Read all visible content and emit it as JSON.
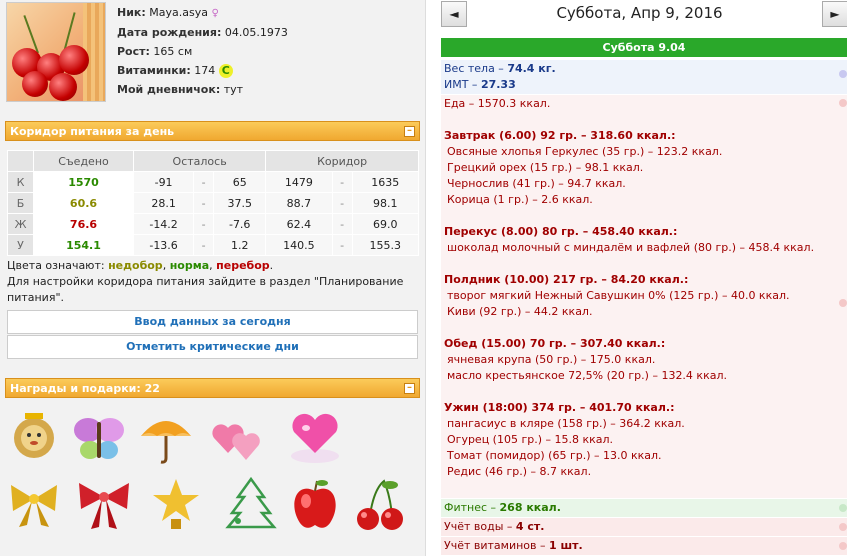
{
  "profile": {
    "nick_label": "Ник:",
    "nick": "Maya.asya",
    "birth_label": "Дата рождения:",
    "birth": "04.05.1973",
    "height_label": "Рост:",
    "height": "165 см",
    "vitamins_label": "Витаминки:",
    "vitamins": "174",
    "vitamin_badge": "C",
    "diary_label": "Мой дневничок:",
    "diary": "тут",
    "gender_icon": "female-icon"
  },
  "corridor": {
    "title": "Коридор питания за день",
    "headers": [
      "",
      "Съедено",
      "Осталось",
      "Коридор"
    ],
    "rows": [
      {
        "label": "К",
        "eaten": "1570",
        "left_from": "-91",
        "left_to": "65",
        "cor_from": "1479",
        "cor_to": "1635",
        "color": "#2a8a00"
      },
      {
        "label": "Б",
        "eaten": "60.6",
        "left_from": "28.1",
        "left_to": "37.5",
        "cor_from": "88.7",
        "cor_to": "98.1",
        "color": "#8a8a00"
      },
      {
        "label": "Ж",
        "eaten": "76.6",
        "left_from": "-14.2",
        "left_to": "-7.6",
        "cor_from": "62.4",
        "cor_to": "69.0",
        "color": "#b80000"
      },
      {
        "label": "У",
        "eaten": "154.1",
        "left_from": "-13.6",
        "left_to": "1.2",
        "cor_from": "140.5",
        "cor_to": "155.3",
        "color": "#2a8a00"
      }
    ],
    "dash": "-",
    "legend_prefix": "Цвета означают:",
    "legend_under": "недобор",
    "legend_norm": "норма",
    "legend_over": "перебор",
    "settings_note": "Для настройки коридора питания зайдите в раздел \"Планирование питания\".",
    "btn_enter": "Ввод данных за сегодня",
    "btn_critical": "Отметить критические дни"
  },
  "gifts": {
    "title": "Награды и подарки: 22",
    "items": [
      "lion-toy-icon",
      "butterfly-icon",
      "umbrella-icon",
      "two-hearts-icon",
      "heart-on-cloud-icon",
      "gold-bow-icon",
      "red-bow-icon",
      "gold-star-icon",
      "christmas-tree-icon",
      "red-apple-icon",
      "cherries-icon"
    ]
  },
  "day": {
    "prev": "◄",
    "next": "►",
    "title": "Суббота, Апр 9, 2016",
    "bar": "Суббота 9.04",
    "weight_label": "Вес тела –",
    "weight": "74.4 кг.",
    "bmi_label": "ИМТ –",
    "bmi": "27.33",
    "food_total": "Еда – 1570.3 ккал.",
    "meals": [
      {
        "title": "Завтрак (6.00) 92 гр. – 318.60 ккал.:",
        "items": [
          "Овсяные хлопья Геркулес (35 гр.) – 123.2 ккал.",
          "Грецкий орех (15 гр.) – 98.1 ккал.",
          "Чернослив (41 гр.) – 94.7 ккал.",
          "Корица (1 гр.) – 2.6 ккал."
        ]
      },
      {
        "title": "Перекус (8.00) 80 гр. – 458.40 ккал.:",
        "items": [
          "шоколад молочный с миндалём и вафлей (80 гр.) – 458.4 ккал."
        ]
      },
      {
        "title": "Полдник (10.00) 217 гр. – 84.20 ккал.:",
        "items": [
          "творог мягкий Нежный Савушкин 0% (125 гр.) – 40.0 ккал.",
          "Киви (92 гр.) – 44.2 ккал."
        ]
      },
      {
        "title": "Обед (15.00) 70 гр. – 307.40 ккал.:",
        "items": [
          "ячневая крупа (50 гр.) – 175.0 ккал.",
          "масло крестьянское 72,5% (20 гр.) – 132.4 ккал."
        ]
      },
      {
        "title": "Ужин (18:00) 374 гр. – 401.70 ккал.:",
        "items": [
          "пангасиус в кляре (158 гр.) – 364.2 ккал.",
          "Огурец (105 гр.) – 15.8 ккал.",
          "Томат (помидор) (65 гр.) – 13.0 ккал.",
          "Редис (46 гр.) – 8.7 ккал."
        ]
      }
    ],
    "fitness_label": "Фитнес –",
    "fitness": "268 ккал.",
    "water_label": "Учёт воды –",
    "water": "4 ст.",
    "vit_label": "Учёт витаминов –",
    "vit": "1 шт."
  }
}
